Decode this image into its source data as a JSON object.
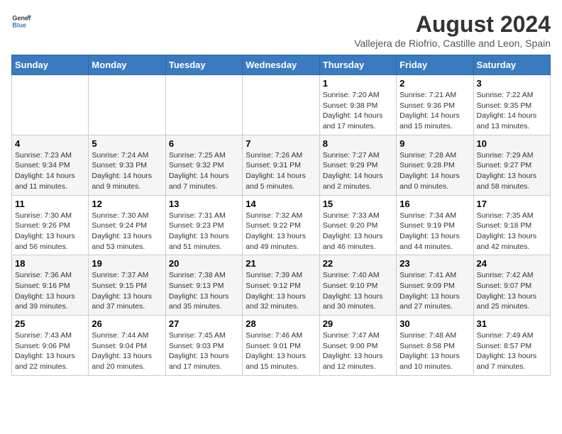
{
  "header": {
    "logo_line1": "General",
    "logo_line2": "Blue",
    "month_year": "August 2024",
    "location": "Vallejera de Riofrio, Castille and Leon, Spain"
  },
  "weekdays": [
    "Sunday",
    "Monday",
    "Tuesday",
    "Wednesday",
    "Thursday",
    "Friday",
    "Saturday"
  ],
  "weeks": [
    [
      {
        "day": "",
        "info": ""
      },
      {
        "day": "",
        "info": ""
      },
      {
        "day": "",
        "info": ""
      },
      {
        "day": "",
        "info": ""
      },
      {
        "day": "1",
        "info": "Sunrise: 7:20 AM\nSunset: 9:38 PM\nDaylight: 14 hours\nand 17 minutes."
      },
      {
        "day": "2",
        "info": "Sunrise: 7:21 AM\nSunset: 9:36 PM\nDaylight: 14 hours\nand 15 minutes."
      },
      {
        "day": "3",
        "info": "Sunrise: 7:22 AM\nSunset: 9:35 PM\nDaylight: 14 hours\nand 13 minutes."
      }
    ],
    [
      {
        "day": "4",
        "info": "Sunrise: 7:23 AM\nSunset: 9:34 PM\nDaylight: 14 hours\nand 11 minutes."
      },
      {
        "day": "5",
        "info": "Sunrise: 7:24 AM\nSunset: 9:33 PM\nDaylight: 14 hours\nand 9 minutes."
      },
      {
        "day": "6",
        "info": "Sunrise: 7:25 AM\nSunset: 9:32 PM\nDaylight: 14 hours\nand 7 minutes."
      },
      {
        "day": "7",
        "info": "Sunrise: 7:26 AM\nSunset: 9:31 PM\nDaylight: 14 hours\nand 5 minutes."
      },
      {
        "day": "8",
        "info": "Sunrise: 7:27 AM\nSunset: 9:29 PM\nDaylight: 14 hours\nand 2 minutes."
      },
      {
        "day": "9",
        "info": "Sunrise: 7:28 AM\nSunset: 9:28 PM\nDaylight: 14 hours\nand 0 minutes."
      },
      {
        "day": "10",
        "info": "Sunrise: 7:29 AM\nSunset: 9:27 PM\nDaylight: 13 hours\nand 58 minutes."
      }
    ],
    [
      {
        "day": "11",
        "info": "Sunrise: 7:30 AM\nSunset: 9:26 PM\nDaylight: 13 hours\nand 56 minutes."
      },
      {
        "day": "12",
        "info": "Sunrise: 7:30 AM\nSunset: 9:24 PM\nDaylight: 13 hours\nand 53 minutes."
      },
      {
        "day": "13",
        "info": "Sunrise: 7:31 AM\nSunset: 9:23 PM\nDaylight: 13 hours\nand 51 minutes."
      },
      {
        "day": "14",
        "info": "Sunrise: 7:32 AM\nSunset: 9:22 PM\nDaylight: 13 hours\nand 49 minutes."
      },
      {
        "day": "15",
        "info": "Sunrise: 7:33 AM\nSunset: 9:20 PM\nDaylight: 13 hours\nand 46 minutes."
      },
      {
        "day": "16",
        "info": "Sunrise: 7:34 AM\nSunset: 9:19 PM\nDaylight: 13 hours\nand 44 minutes."
      },
      {
        "day": "17",
        "info": "Sunrise: 7:35 AM\nSunset: 9:18 PM\nDaylight: 13 hours\nand 42 minutes."
      }
    ],
    [
      {
        "day": "18",
        "info": "Sunrise: 7:36 AM\nSunset: 9:16 PM\nDaylight: 13 hours\nand 39 minutes."
      },
      {
        "day": "19",
        "info": "Sunrise: 7:37 AM\nSunset: 9:15 PM\nDaylight: 13 hours\nand 37 minutes."
      },
      {
        "day": "20",
        "info": "Sunrise: 7:38 AM\nSunset: 9:13 PM\nDaylight: 13 hours\nand 35 minutes."
      },
      {
        "day": "21",
        "info": "Sunrise: 7:39 AM\nSunset: 9:12 PM\nDaylight: 13 hours\nand 32 minutes."
      },
      {
        "day": "22",
        "info": "Sunrise: 7:40 AM\nSunset: 9:10 PM\nDaylight: 13 hours\nand 30 minutes."
      },
      {
        "day": "23",
        "info": "Sunrise: 7:41 AM\nSunset: 9:09 PM\nDaylight: 13 hours\nand 27 minutes."
      },
      {
        "day": "24",
        "info": "Sunrise: 7:42 AM\nSunset: 9:07 PM\nDaylight: 13 hours\nand 25 minutes."
      }
    ],
    [
      {
        "day": "25",
        "info": "Sunrise: 7:43 AM\nSunset: 9:06 PM\nDaylight: 13 hours\nand 22 minutes."
      },
      {
        "day": "26",
        "info": "Sunrise: 7:44 AM\nSunset: 9:04 PM\nDaylight: 13 hours\nand 20 minutes."
      },
      {
        "day": "27",
        "info": "Sunrise: 7:45 AM\nSunset: 9:03 PM\nDaylight: 13 hours\nand 17 minutes."
      },
      {
        "day": "28",
        "info": "Sunrise: 7:46 AM\nSunset: 9:01 PM\nDaylight: 13 hours\nand 15 minutes."
      },
      {
        "day": "29",
        "info": "Sunrise: 7:47 AM\nSunset: 9:00 PM\nDaylight: 13 hours\nand 12 minutes."
      },
      {
        "day": "30",
        "info": "Sunrise: 7:48 AM\nSunset: 8:58 PM\nDaylight: 13 hours\nand 10 minutes."
      },
      {
        "day": "31",
        "info": "Sunrise: 7:49 AM\nSunset: 8:57 PM\nDaylight: 13 hours\nand 7 minutes."
      }
    ]
  ]
}
